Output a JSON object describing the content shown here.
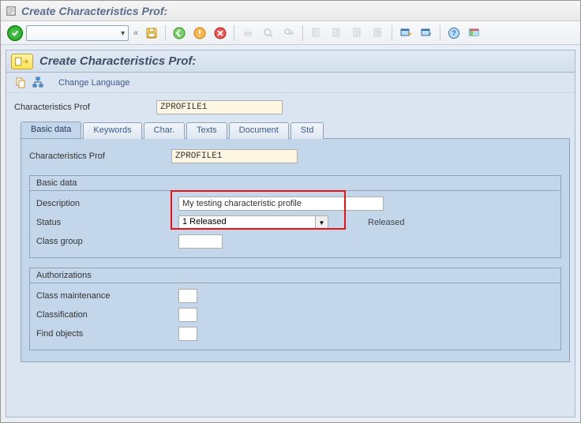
{
  "window": {
    "title": "Create Characteristics Prof:"
  },
  "panel": {
    "title": "Create Characteristics Prof:",
    "change_language": "Change Language"
  },
  "topfield": {
    "label": "Characteristics Prof",
    "value": "ZPROFILE1"
  },
  "tabs": {
    "basic_data": "Basic data",
    "keywords": "Keywords",
    "char": "Char.",
    "texts": "Texts",
    "document": "Document",
    "std": "Std"
  },
  "basic_panel": {
    "char_prof_label": "Characteristics Prof",
    "char_prof_value": "ZPROFILE1",
    "group_title": "Basic data",
    "description_label": "Description",
    "description_value": "My testing characteristic profile",
    "status_label": "Status",
    "status_value": "1 Released",
    "status_readable": "Released",
    "class_group_label": "Class group"
  },
  "auth_panel": {
    "group_title": "Authorizations",
    "class_maintenance": "Class maintenance",
    "classification": "Classification",
    "find_objects": "Find objects"
  }
}
